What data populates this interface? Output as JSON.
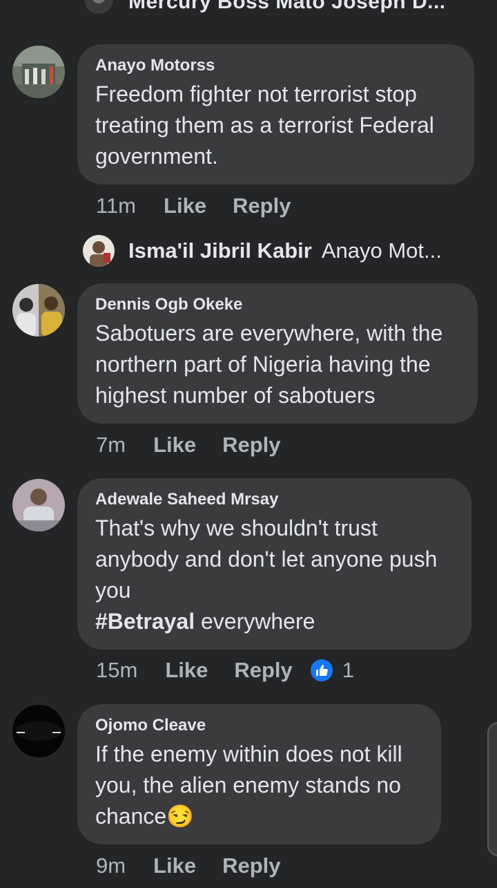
{
  "top_comment": {
    "text": "Mercury Boss Mato Joseph D..."
  },
  "comments": [
    {
      "author": "Anayo Motorss",
      "lines": [
        "Freedom fighter not terrorist stop",
        "treating them as a terrorist Federal",
        "government."
      ],
      "time": "11m",
      "like": "Like",
      "reply": "Reply"
    },
    {
      "author": "Dennis Ogb Okeke",
      "lines": [
        "Sabotuers are everywhere, with the",
        "northern part of Nigeria having the",
        "highest number of sabotuers"
      ],
      "time": "7m",
      "like": "Like",
      "reply": "Reply"
    },
    {
      "author": "Adewale Saheed Mrsay",
      "lines": [
        "That's why we shouldn't trust",
        "anybody and don't let anyone push",
        "you"
      ],
      "hashtag": "#Betrayal",
      "hashtag_rest": " everywhere",
      "time": "15m",
      "like": "Like",
      "reply": "Reply",
      "reaction_count": "1",
      "reaction_icon": "like-icon"
    },
    {
      "author": "Ojomo Cleave",
      "lines": [
        "If the enemy within does not kill",
        "you, the alien enemy stands no",
        "chance"
      ],
      "emoji": "😏",
      "time": "9m",
      "like": "Like",
      "reply": "Reply"
    }
  ],
  "reply_preview": {
    "author": "Isma'il Jibril Kabir",
    "text": "Anayo Mot..."
  },
  "colors": {
    "background": "#242526",
    "bubble": "#3a3b3c",
    "text": "#e4e6eb",
    "meta": "#b0b3b8",
    "accent": "#1877f2"
  }
}
